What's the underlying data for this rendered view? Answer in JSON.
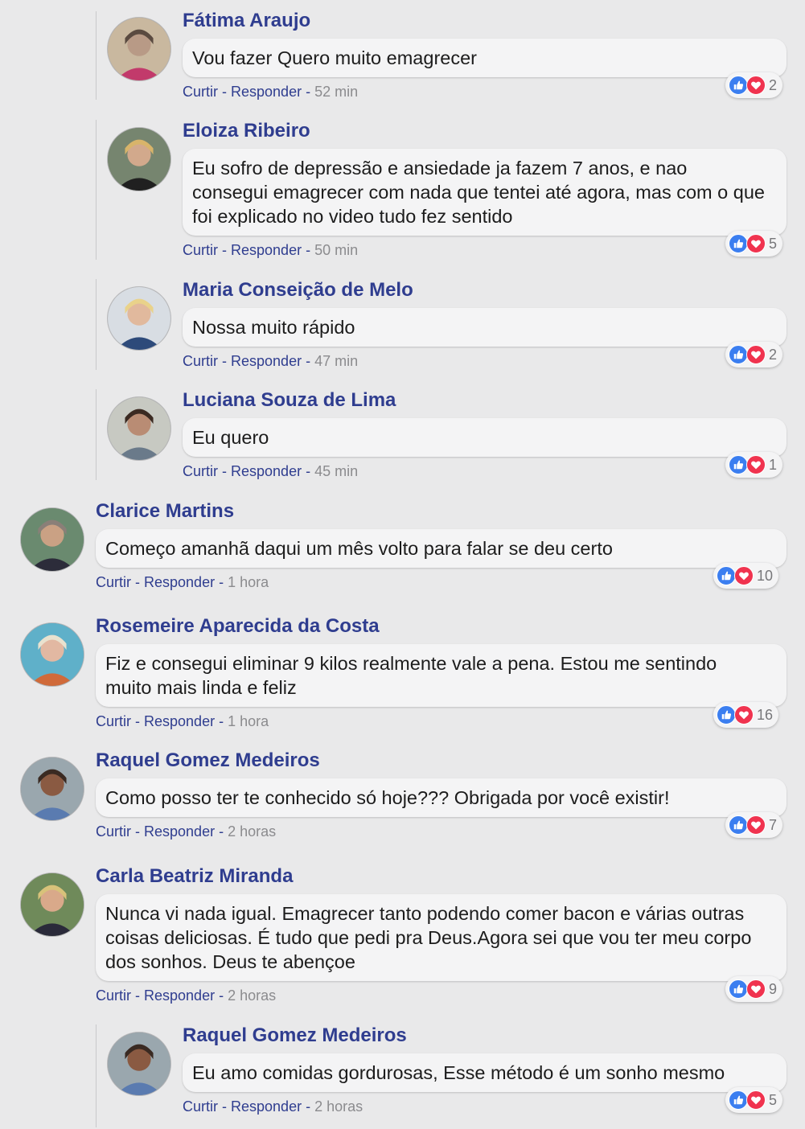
{
  "labels": {
    "like": "Curtir",
    "reply": "Responder",
    "separator": "-"
  },
  "colors": {
    "name": "#2f3d8f",
    "like": "#3b7ef0",
    "love": "#f0334f",
    "time": "#8b8b8e"
  },
  "comments": [
    {
      "name": "Fátima Araujo",
      "text": "Vou fazer Quero muito emagrecer",
      "time": "52 min",
      "reactions": "2",
      "reply": true
    },
    {
      "name": "Eloiza Ribeiro",
      "text": "Eu sofro de depressão e ansiedade ja fazem 7 anos, e nao\nconsegui emagrecer com nada que tentei até agora, mas com o que\nfoi explicado no video tudo fez sentido",
      "time": "50 min",
      "reactions": "5",
      "reply": true
    },
    {
      "name": "Maria Conseição de Melo",
      "text": "Nossa muito rápido",
      "time": "47 min",
      "reactions": "2",
      "reply": true
    },
    {
      "name": "Luciana Souza de Lima",
      "text": "Eu quero",
      "time": "45 min",
      "reactions": "1",
      "reply": true
    },
    {
      "name": "Clarice Martins",
      "text": "Começo amanhã daqui um mês volto para falar se deu certo",
      "time": "1 hora",
      "reactions": "10",
      "reply": false
    },
    {
      "name": "Rosemeire Aparecida da Costa",
      "text": "Fiz e consegui eliminar 9 kilos realmente vale a pena. Estou me sentindo\nmuito mais linda e feliz",
      "time": "1 hora",
      "reactions": "16",
      "reply": false
    },
    {
      "name": "Raquel Gomez Medeiros",
      "text": "Como posso ter te conhecido só hoje??? Obrigada por você existir!",
      "time": "2 horas",
      "reactions": "7",
      "reply": false
    },
    {
      "name": "Carla Beatriz Miranda",
      "text": "Nunca vi nada igual. Emagrecer tanto podendo comer bacon e várias outras\ncoisas deliciosas. É tudo que pedi pra Deus.Agora sei que vou ter meu corpo\ndos sonhos. Deus te abençoe",
      "time": "2 horas",
      "reactions": "9",
      "reply": false
    },
    {
      "name": "Raquel Gomez Medeiros",
      "text": "Eu amo comidas gordurosas, Esse método é um sonho mesmo",
      "time": "2 horas",
      "reactions": "5",
      "reply": true
    }
  ]
}
